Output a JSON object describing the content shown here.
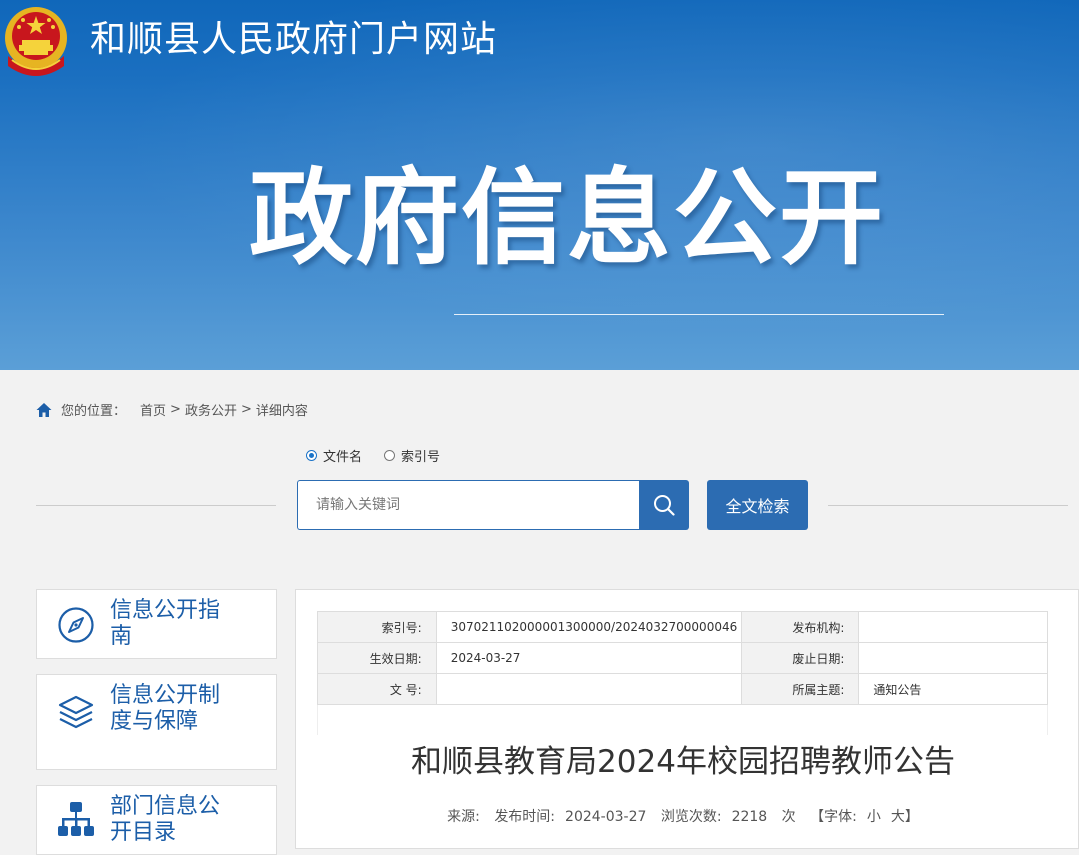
{
  "header": {
    "site_title": "和顺县人民政府门户网站",
    "hero_title": "政府信息公开"
  },
  "breadcrumb": {
    "prefix": "您的位置：",
    "items": [
      "首页",
      "政务公开",
      "详细内容"
    ],
    "separator": ">"
  },
  "search": {
    "options": [
      "文件名",
      "索引号"
    ],
    "selected": "文件名",
    "placeholder": "请输入关键词",
    "fulltext_label": "全文检索"
  },
  "sidebar": {
    "items": [
      {
        "label": "信息公开指南",
        "icon": "compass-icon"
      },
      {
        "label": "信息公开制度与保障",
        "icon": "layers-icon"
      },
      {
        "label": "部门信息公开目录",
        "icon": "org-chart-icon"
      }
    ]
  },
  "document": {
    "meta": {
      "index_label": "索引号:",
      "index_value": "307021102000001300000/2024032700000046",
      "publisher_label": "发布机构:",
      "publisher_value": "",
      "effective_label": "生效日期:",
      "effective_value": "2024-03-27",
      "expiry_label": "废止日期:",
      "expiry_value": "",
      "docno_label": "文 号:",
      "docno_value": "",
      "topic_label": "所属主题:",
      "topic_value": "通知公告"
    },
    "title": "和顺县教育局2024年校园招聘教师公告",
    "info": {
      "source_label": "来源:",
      "date_label": "发布时间:",
      "date_value": "2024-03-27",
      "views_label": "浏览次数:",
      "views_value": "2218",
      "views_unit": "次",
      "font_label": "【字体:",
      "font_small": "小",
      "font_large": "大】"
    }
  },
  "colors": {
    "brand_blue": "#2c6cb2",
    "link_blue": "#1c5ea8",
    "banner_top": "#1067ba",
    "banner_bottom": "#5b9fd7"
  }
}
